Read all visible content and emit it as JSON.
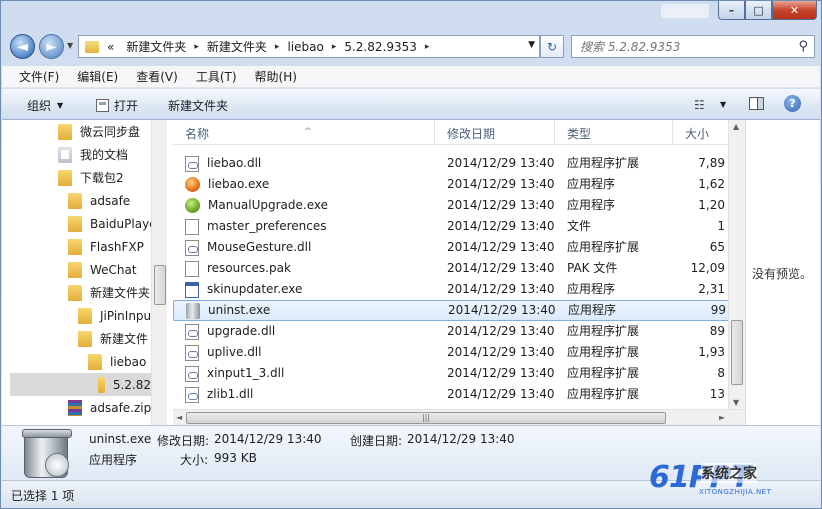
{
  "window": {
    "caption_buttons": {
      "minimize": "–",
      "maximize": "□",
      "close": "✕"
    }
  },
  "nav": {
    "back_glyph": "◄",
    "forward_glyph": "►",
    "history_dropdown": "▼",
    "address": {
      "overflow": "«",
      "crumbs": [
        "新建文件夹",
        "新建文件夹",
        "liebao",
        "5.2.82.9353"
      ],
      "separator": "▸",
      "dropdown": "▼"
    },
    "refresh_glyph": "↻",
    "search": {
      "placeholder": "搜索 5.2.82.9353",
      "icon": "search-icon",
      "glyph": "⚲"
    }
  },
  "menubar": [
    "文件(F)",
    "编辑(E)",
    "查看(V)",
    "工具(T)",
    "帮助(H)"
  ],
  "commandbar": {
    "organize": "组织",
    "organize_dd": "▼",
    "open": "打开",
    "new_folder": "新建文件夹",
    "views_glyph": "☷",
    "views_dd": "▼",
    "help_glyph": "?"
  },
  "navpane": {
    "items": [
      {
        "label": "微云同步盘",
        "icon": "folder"
      },
      {
        "label": "我的文档",
        "icon": "documents"
      },
      {
        "label": "下载包2",
        "icon": "folder"
      },
      {
        "label": "adsafe",
        "icon": "folder"
      },
      {
        "label": "BaiduPlaye",
        "icon": "folder"
      },
      {
        "label": "FlashFXP",
        "icon": "folder"
      },
      {
        "label": "WeChat",
        "icon": "folder"
      },
      {
        "label": "新建文件夹",
        "icon": "folder"
      },
      {
        "label": "JiPinInpu",
        "icon": "folder"
      },
      {
        "label": "新建文件",
        "icon": "folder"
      },
      {
        "label": "liebao",
        "icon": "folder"
      },
      {
        "label": "5.2.82",
        "icon": "folder",
        "selected": true
      },
      {
        "label": "adsafe.zip",
        "icon": "zip"
      }
    ]
  },
  "filelist": {
    "columns": {
      "name": "名称",
      "date": "修改日期",
      "type": "类型",
      "size": "大小"
    },
    "sort_glyph": "^",
    "rows": [
      {
        "name": "liebao.dll",
        "date": "2014/12/29 13:40",
        "type": "应用程序扩展",
        "size": "7,89",
        "icon": "dll"
      },
      {
        "name": "liebao.exe",
        "date": "2014/12/29 13:40",
        "type": "应用程序",
        "size": "1,62",
        "icon": "exe-orange"
      },
      {
        "name": "ManualUpgrade.exe",
        "date": "2014/12/29 13:40",
        "type": "应用程序",
        "size": "1,20",
        "icon": "exe-green"
      },
      {
        "name": "master_preferences",
        "date": "2014/12/29 13:40",
        "type": "文件",
        "size": "1",
        "icon": "file"
      },
      {
        "name": "MouseGesture.dll",
        "date": "2014/12/29 13:40",
        "type": "应用程序扩展",
        "size": "65",
        "icon": "dll"
      },
      {
        "name": "resources.pak",
        "date": "2014/12/29 13:40",
        "type": "PAK 文件",
        "size": "12,09",
        "icon": "file"
      },
      {
        "name": "skinupdater.exe",
        "date": "2014/12/29 13:40",
        "type": "应用程序",
        "size": "2,31",
        "icon": "exe-blue"
      },
      {
        "name": "uninst.exe",
        "date": "2014/12/29 13:40",
        "type": "应用程序",
        "size": "99",
        "icon": "exe-trash",
        "selected": true
      },
      {
        "name": "upgrade.dll",
        "date": "2014/12/29 13:40",
        "type": "应用程序扩展",
        "size": "89",
        "icon": "dll"
      },
      {
        "name": "uplive.dll",
        "date": "2014/12/29 13:40",
        "type": "应用程序扩展",
        "size": "1,93",
        "icon": "dll"
      },
      {
        "name": "xinput1_3.dll",
        "date": "2014/12/29 13:40",
        "type": "应用程序扩展",
        "size": "8",
        "icon": "dll"
      },
      {
        "name": "zlib1.dll",
        "date": "2014/12/29 13:40",
        "type": "应用程序扩展",
        "size": "13",
        "icon": "dll"
      }
    ],
    "hscroll_left": "◄",
    "hscroll_right": "►",
    "hscroll_grip": "|||",
    "vscroll_up": "▲",
    "vscroll_down": "▼"
  },
  "preview": {
    "text": "没有预览。"
  },
  "details": {
    "filename": "uninst.exe",
    "modified_label": "修改日期:",
    "modified": "2014/12/29 13:40",
    "created_label": "创建日期:",
    "created": "2014/12/29 13:40",
    "type": "应用程序",
    "size_label": "大小:",
    "size": "993 KB"
  },
  "statusbar": {
    "text": "已选择 1 项"
  },
  "watermark": {
    "main": "61PPT",
    "cn": "系统之家",
    "sub": "XITONGZHIJIA.NET"
  },
  "colors": {
    "accent": "#2b6ad6",
    "selection_border": "#84acdd",
    "frame": "#cfdcef"
  }
}
